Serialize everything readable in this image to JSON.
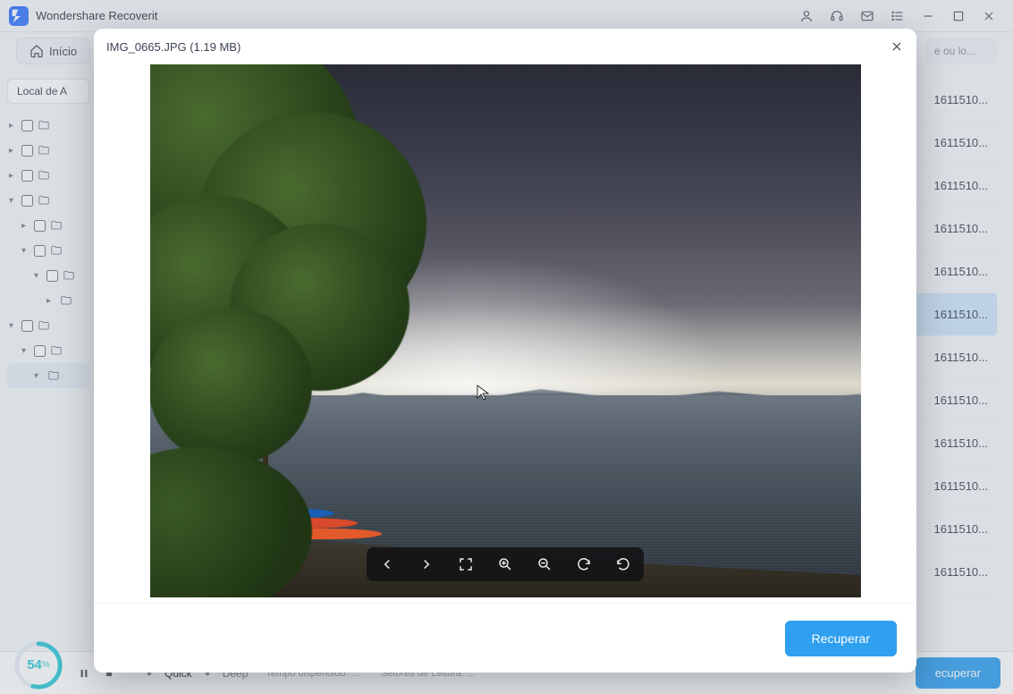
{
  "app": {
    "title": "Wondershare Recoverit"
  },
  "titlebar_icons": [
    "user",
    "headset",
    "mail",
    "list",
    "minimize",
    "maximize",
    "close"
  ],
  "toolbar": {
    "home_label": "Início",
    "search_stub": "e ou lo..."
  },
  "sidebar": {
    "filter_label": "Local de A",
    "rows": [
      {
        "indent": 0,
        "caret": "right",
        "checkbox": true,
        "selected": false
      },
      {
        "indent": 0,
        "caret": "right",
        "checkbox": true,
        "selected": false
      },
      {
        "indent": 0,
        "caret": "right",
        "checkbox": true,
        "selected": false
      },
      {
        "indent": 0,
        "caret": "down",
        "checkbox": true,
        "selected": false
      },
      {
        "indent": 1,
        "caret": "right",
        "checkbox": true,
        "selected": false
      },
      {
        "indent": 1,
        "caret": "down",
        "checkbox": true,
        "selected": false
      },
      {
        "indent": 2,
        "caret": "down",
        "checkbox": true,
        "selected": false
      },
      {
        "indent": 3,
        "caret": "right",
        "checkbox": false,
        "selected": false
      },
      {
        "indent": 0,
        "caret": "down",
        "checkbox": true,
        "selected": false
      },
      {
        "indent": 1,
        "caret": "down",
        "checkbox": true,
        "selected": false
      },
      {
        "indent": 2,
        "caret": "down",
        "checkbox": false,
        "selected": true
      }
    ]
  },
  "results": {
    "rows": [
      {
        "text": "1611510...",
        "selected": false
      },
      {
        "text": "1611510...",
        "selected": false
      },
      {
        "text": "1611510...",
        "selected": false
      },
      {
        "text": "1611510...",
        "selected": false
      },
      {
        "text": "1611510...",
        "selected": false
      },
      {
        "text": "1611510...",
        "selected": true
      },
      {
        "text": "1611510...",
        "selected": false
      },
      {
        "text": "1611510...",
        "selected": false
      },
      {
        "text": "1611510...",
        "selected": false
      },
      {
        "text": "1611510...",
        "selected": false
      },
      {
        "text": "1611510...",
        "selected": false
      },
      {
        "text": "1611510...",
        "selected": false
      }
    ]
  },
  "status": {
    "progress_percent": 54,
    "progress_suffix": "%",
    "mode_quick": "Quick",
    "mode_deep": "Deep",
    "time_label": "Tempo dispendido: ...",
    "sectors_label": "Setores de Leitura: ...",
    "recover_label": "ecuperar"
  },
  "modal": {
    "filename": "IMG_0665.JPG",
    "filesize": "(1.19 MB)",
    "title_combined": "IMG_0665.JPG (1.19 MB)",
    "recover_label": "Recuperar",
    "toolbar_icons": [
      "prev",
      "next",
      "fullscreen",
      "zoom-in",
      "zoom-out",
      "rotate-cw",
      "rotate-ccw"
    ]
  }
}
